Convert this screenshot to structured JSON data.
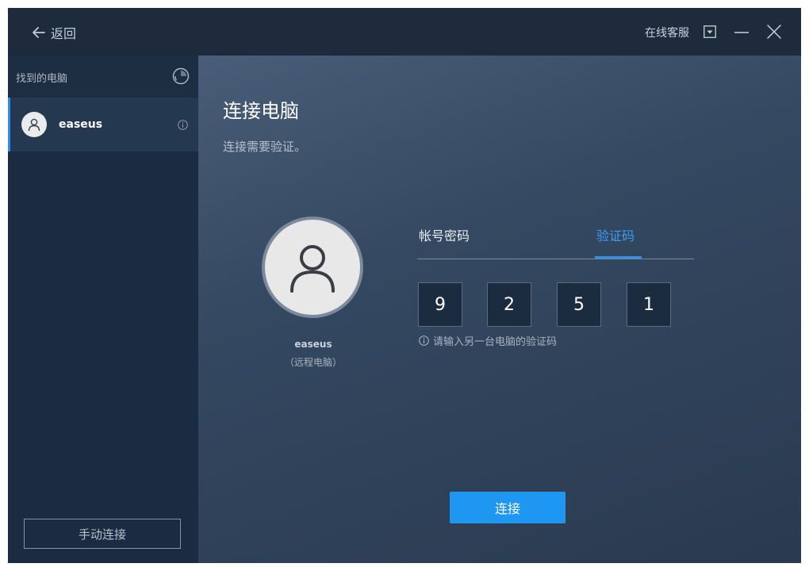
{
  "titlebar": {
    "back_label": "返回",
    "support_label": "在线客服"
  },
  "sidebar": {
    "header_label": "找到的电脑",
    "computers": [
      {
        "name": "easeus"
      }
    ],
    "manual_connect_label": "手动连接"
  },
  "main": {
    "title": "连接电脑",
    "subtitle": "连接需要验证。",
    "remote": {
      "name": "easeus",
      "type_label": "（远程电脑）"
    },
    "tabs": [
      {
        "label": "帐号密码",
        "active": false
      },
      {
        "label": "验证码",
        "active": true
      }
    ],
    "code_digits": [
      "9",
      "2",
      "5",
      "1"
    ],
    "hint": "请输入另一台电脑的验证码",
    "connect_label": "连接"
  },
  "colors": {
    "accent": "#1e97f3",
    "active_tab": "#3c9cf0",
    "sidebar_bg": "#1a2b42",
    "titlebar_bg": "#1d2b3d"
  }
}
